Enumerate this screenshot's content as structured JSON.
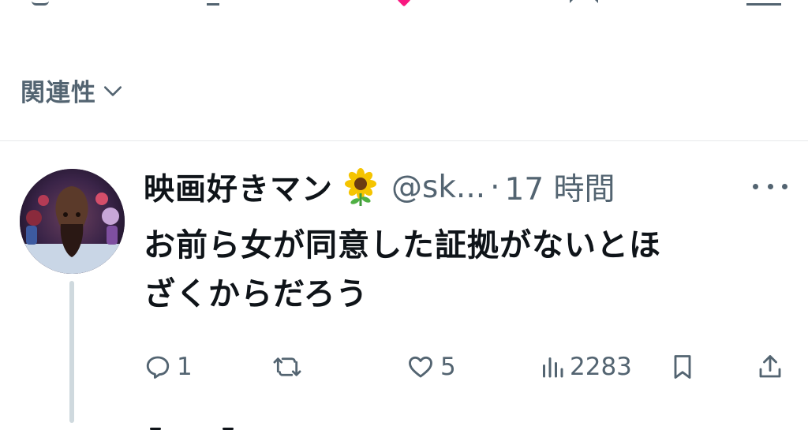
{
  "sort": {
    "label": "関連性",
    "icon": "chevron-down-icon"
  },
  "tweet": {
    "display_name": "映画好きマン",
    "name_emoji": "sunflower-icon",
    "handle": "@sk...",
    "separator": "·",
    "time": "17 時間",
    "text_lines": [
      "お前ら女が同意した証拠がないとほ",
      "ざくからだろう"
    ],
    "actions": {
      "reply_count": "1",
      "retweet_count": "",
      "like_count": "5",
      "views_count": "2283"
    }
  },
  "colors": {
    "text_primary": "#0f1419",
    "text_secondary": "#536471",
    "divider": "#e6e9eb",
    "thread_line": "#cfd9de",
    "like_accent": "#f91880"
  }
}
